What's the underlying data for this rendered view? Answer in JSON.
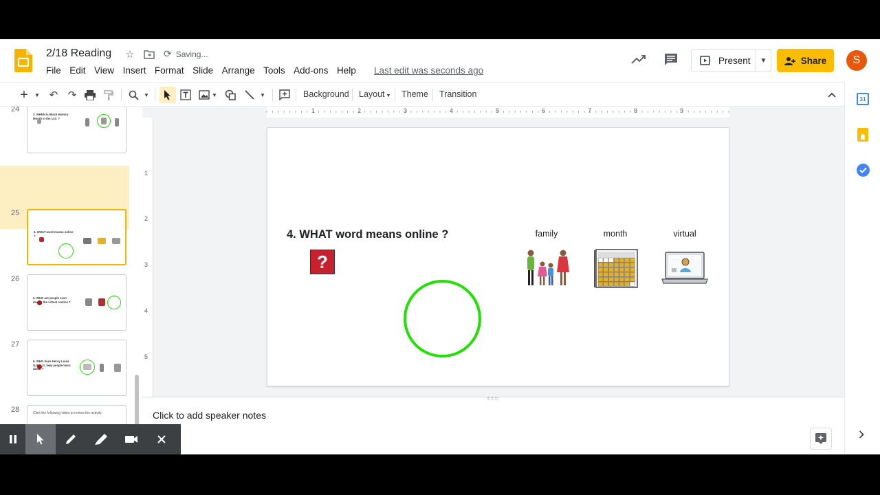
{
  "doc": {
    "title": "2/18 Reading",
    "saving": "Saving...",
    "last_edit": "Last edit was seconds ago"
  },
  "menu": [
    "File",
    "Edit",
    "View",
    "Insert",
    "Format",
    "Slide",
    "Arrange",
    "Tools",
    "Add-ons",
    "Help"
  ],
  "header_buttons": {
    "present": "Present",
    "share": "Share",
    "avatar_initial": "S"
  },
  "toolbar": {
    "background": "Background",
    "layout": "Layout",
    "theme": "Theme",
    "transition": "Transition"
  },
  "ruler": {
    "top": [
      "1",
      "2",
      "3",
      "4",
      "5",
      "6",
      "7",
      "8",
      "9"
    ],
    "left": [
      "1",
      "2",
      "3",
      "4",
      "5"
    ]
  },
  "filmstrip": [
    {
      "num": "24",
      "text": "3. WHEN is Black History Month in the U.S. ?"
    },
    {
      "num": "25",
      "text": "4. WHAT word means online ?"
    },
    {
      "num": "26",
      "text": "5. WHO are people seen during the virtual routine ?"
    },
    {
      "num": "27",
      "text": "6. WHO does Henry Louis Gates Jr. help people learn about ?"
    },
    {
      "num": "28",
      "text": "Click the following video to review the activity"
    }
  ],
  "slide": {
    "question": "4.  WHAT  word means online ?",
    "qmark": "?",
    "choices": [
      "family",
      "month",
      "virtual"
    ]
  },
  "notes": {
    "placeholder": "Click to add speaker notes"
  },
  "colors": {
    "share_yellow": "#fbbc04",
    "selected_slide_border": "#f4b400",
    "selected_slide_bg": "#feefc3",
    "circle_green": "#22e000",
    "avatar_orange": "#e8580c"
  },
  "icons": [
    "slides-logo-icon",
    "star-icon",
    "move-folder-icon",
    "sync-icon",
    "trend-icon",
    "comment-icon",
    "present-icon",
    "lock-icon",
    "calendar-icon",
    "keep-icon",
    "tasks-icon",
    "pause-icon",
    "pointer-icon",
    "pen-icon",
    "highlighter-icon",
    "camera-icon",
    "close-icon"
  ]
}
